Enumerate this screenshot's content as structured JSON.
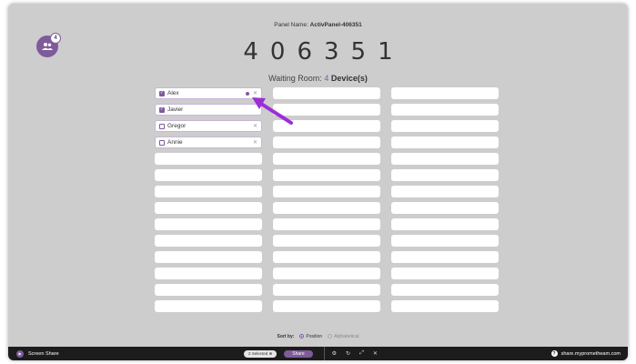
{
  "header": {
    "panel_name_label": "Panel Name:",
    "panel_name_value": "ActivPanel-406351",
    "pin": "406351",
    "waiting_prefix": "Waiting Room:",
    "waiting_count": "4",
    "waiting_suffix": "Device(s)",
    "devices_badge_count": "4"
  },
  "devices": [
    {
      "name": "Alex",
      "checked": true,
      "status_dot": true
    },
    {
      "name": "Javier",
      "checked": true,
      "status_dot": false
    },
    {
      "name": "Gregor",
      "checked": false,
      "status_dot": false
    },
    {
      "name": "Annie",
      "checked": false,
      "status_dot": false
    }
  ],
  "sort": {
    "label": "Sort by:",
    "option_position": "Position",
    "option_alphabetical": "Alphabetical",
    "selected": "Position"
  },
  "bottombar": {
    "app_label": "Screen Share",
    "selected_pill": "2 Selected",
    "share_label": "Share",
    "url": "share.myprometheam.com"
  },
  "colors": {
    "accent": "#7f5b9a",
    "arrow": "#9b2fd6",
    "background": "#cdcdcd",
    "bottombar": "#1c1c1c"
  }
}
